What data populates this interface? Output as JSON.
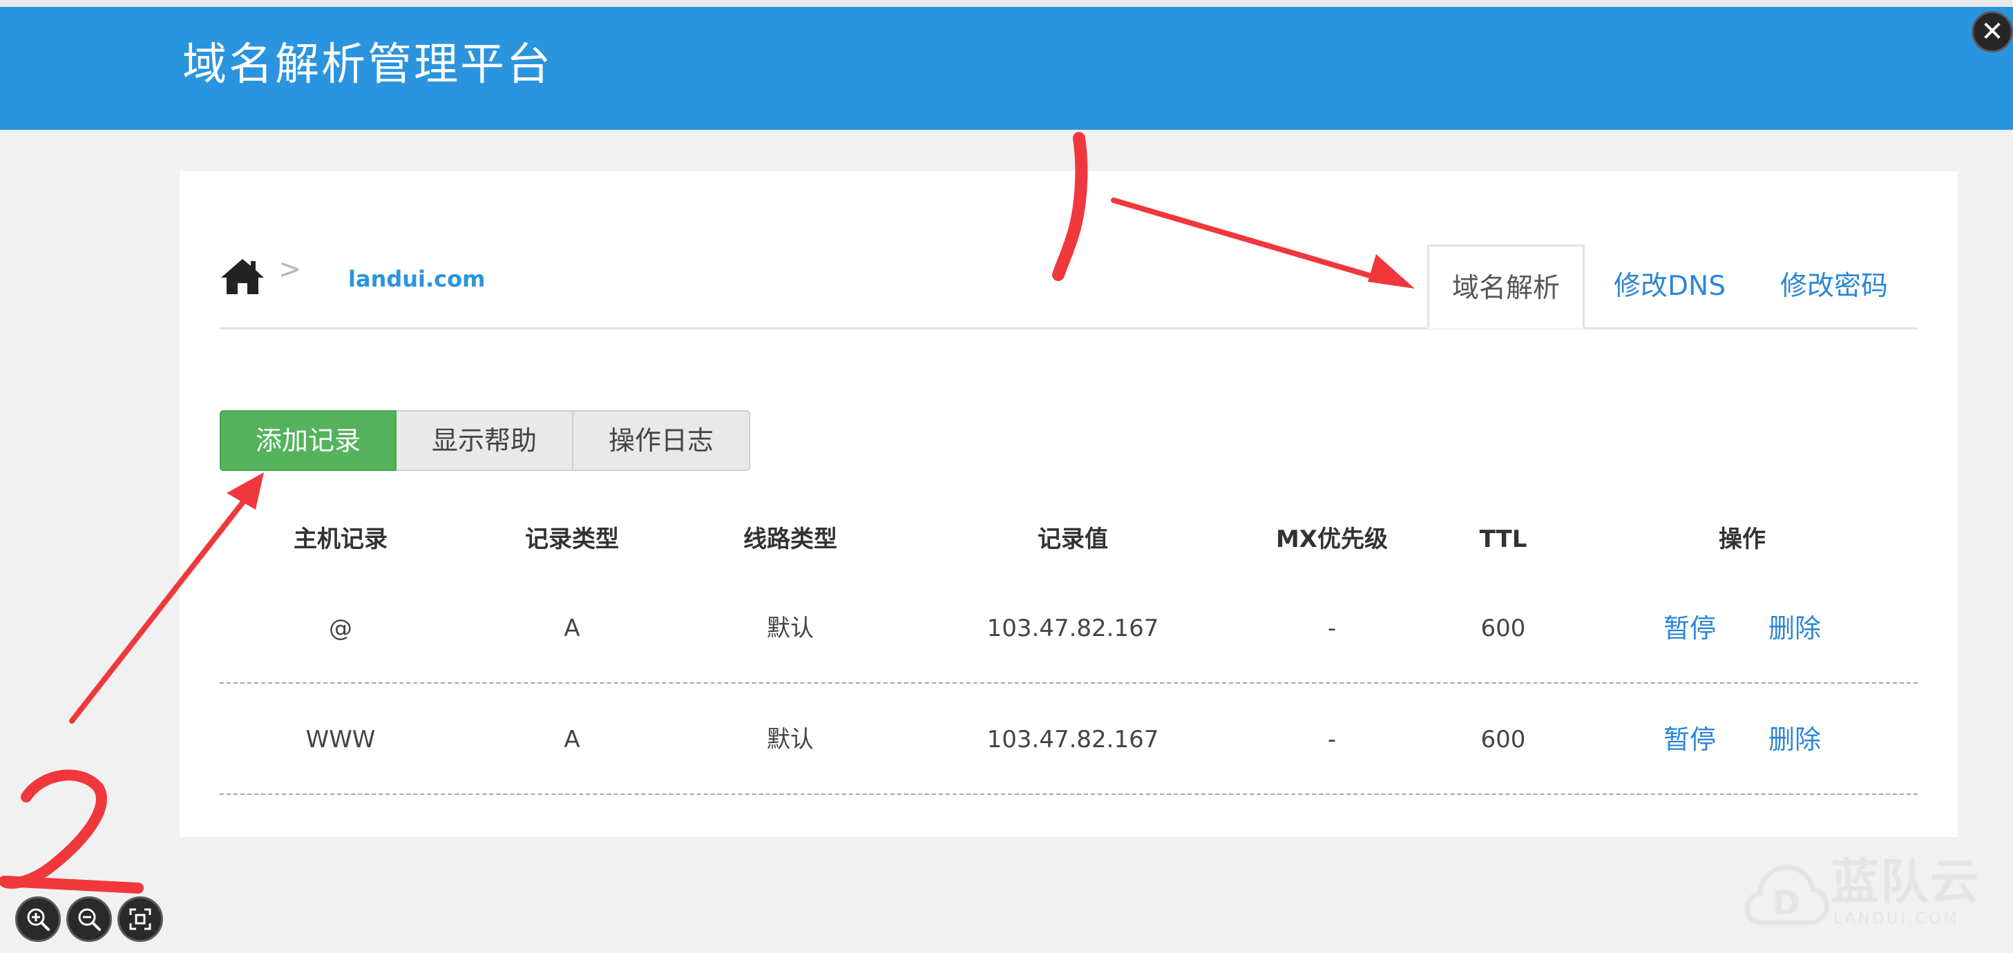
{
  "header": {
    "title": "域名解析管理平台",
    "color": "#2b94de"
  },
  "breadcrumb": {
    "home_icon": "home-icon",
    "separator": ">",
    "domain": "landui.com"
  },
  "tabs": [
    {
      "label": "域名解析",
      "active": true
    },
    {
      "label": "修改DNS",
      "active": false
    },
    {
      "label": "修改密码",
      "active": false
    }
  ],
  "actions": {
    "add_record": "添加记录",
    "show_help": "显示帮助",
    "operation_log": "操作日志"
  },
  "table": {
    "columns": [
      "主机记录",
      "记录类型",
      "线路类型",
      "记录值",
      "MX优先级",
      "TTL",
      "操作"
    ],
    "rows": [
      {
        "host": "@",
        "type": "A",
        "line": "默认",
        "value": "103.47.82.167",
        "mx": "-",
        "ttl": "600",
        "pause": "暂停",
        "delete": "删除"
      },
      {
        "host": "WWW",
        "type": "A",
        "line": "默认",
        "value": "103.47.82.167",
        "mx": "-",
        "ttl": "600",
        "pause": "暂停",
        "delete": "删除"
      }
    ]
  },
  "annotations": {
    "label_1": "1",
    "label_2": "2",
    "color": "#f0383c"
  },
  "viewer_controls": [
    "zoom-in-icon",
    "zoom-out-icon",
    "fullscreen-icon"
  ],
  "watermark": {
    "text": "蓝队云",
    "sub": "LANDUI.COM"
  }
}
